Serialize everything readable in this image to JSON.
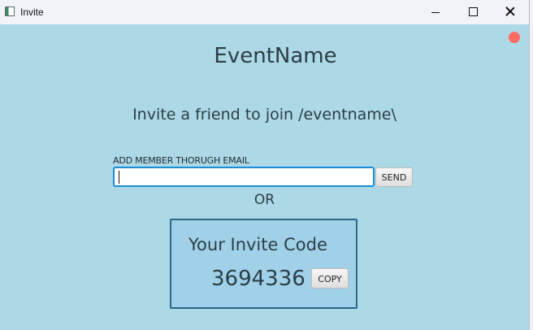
{
  "window": {
    "title": "Invite",
    "app_icon": "window-app-icon",
    "controls": {
      "minimize_icon": "minimize-icon",
      "maximize_icon": "maximize-icon",
      "close_icon": "close-icon"
    }
  },
  "main": {
    "event_name": "EventName",
    "invite_text": "Invite a friend to join /eventname\\",
    "email_label": "ADD MEMBER THORUGH EMAIL",
    "email_value": "",
    "email_placeholder": "",
    "send_label": "SEND",
    "or_text": "OR",
    "code_title": "Your Invite Code",
    "code_value": "3694336",
    "copy_label": "COPY"
  },
  "colors": {
    "background": "#add8e6",
    "code_box": "#a1d1e8",
    "focus_border": "#1a8ed8",
    "status_dot": "#ff6b61"
  }
}
